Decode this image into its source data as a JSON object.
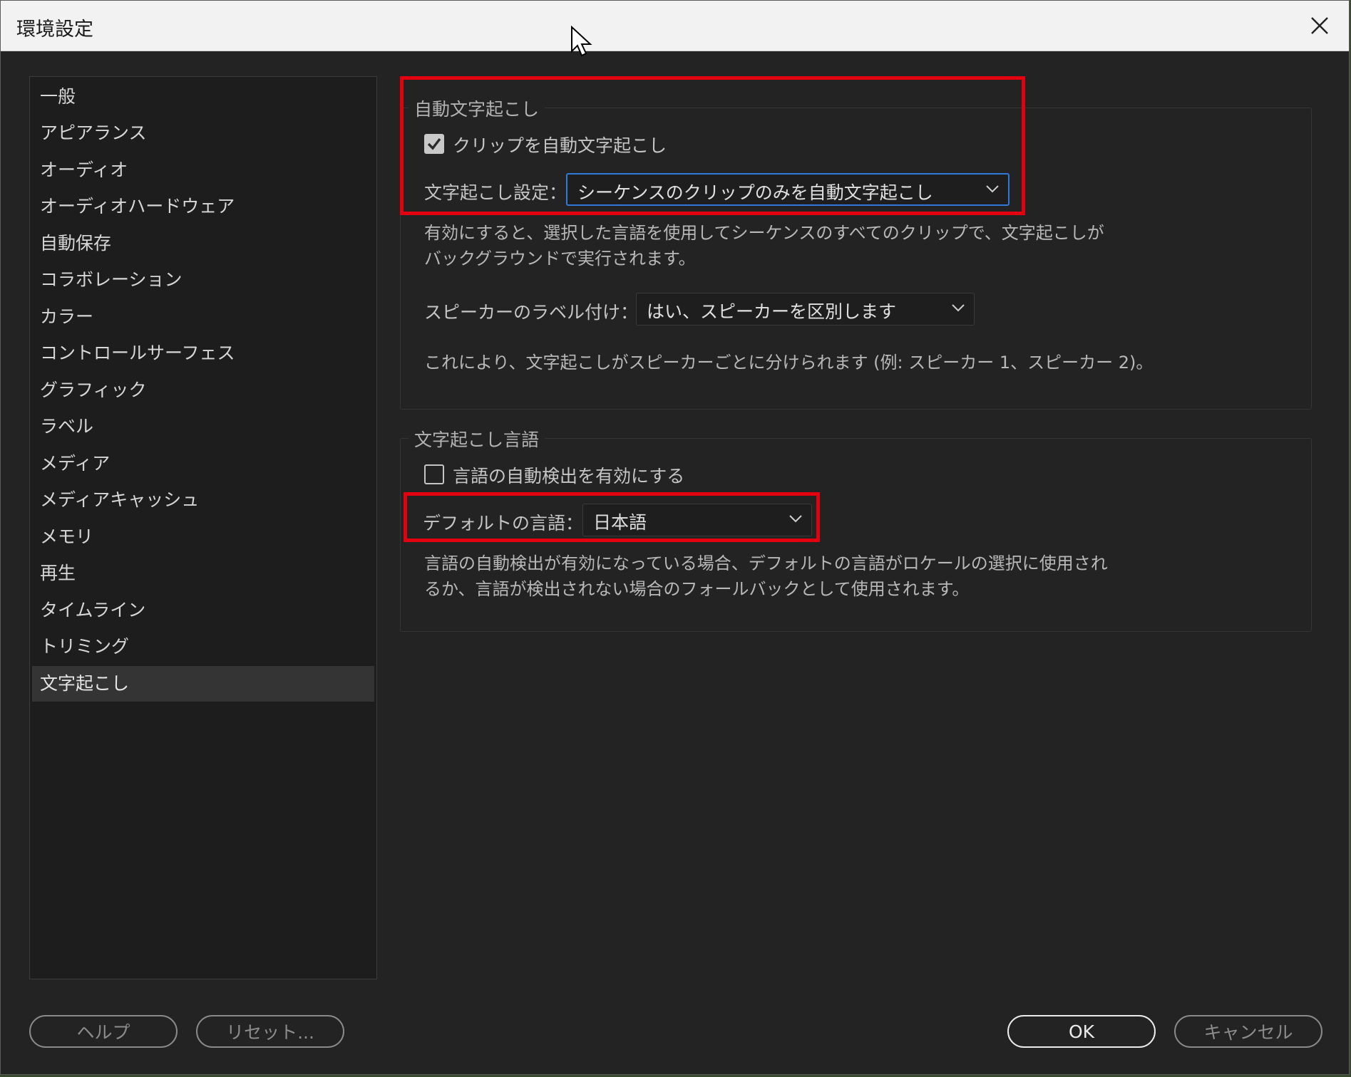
{
  "window": {
    "title": "環境設定"
  },
  "sidebar": {
    "items": [
      {
        "label": "一般"
      },
      {
        "label": "アピアランス"
      },
      {
        "label": "オーディオ"
      },
      {
        "label": "オーディオハードウェア"
      },
      {
        "label": "自動保存"
      },
      {
        "label": "コラボレーション"
      },
      {
        "label": "カラー"
      },
      {
        "label": "コントロールサーフェス"
      },
      {
        "label": "グラフィック"
      },
      {
        "label": "ラベル"
      },
      {
        "label": "メディア"
      },
      {
        "label": "メディアキャッシュ"
      },
      {
        "label": "メモリ"
      },
      {
        "label": "再生"
      },
      {
        "label": "タイムライン"
      },
      {
        "label": "トリミング"
      },
      {
        "label": "文字起こし"
      }
    ],
    "selected": "文字起こし"
  },
  "auto_transcribe": {
    "group_label": "自動文字起こし",
    "checkbox_label": "クリップを自動文字起こし",
    "checkbox_checked": true,
    "setting_label": "文字起こし設定：",
    "setting_value": "シーケンスのクリップのみを自動文字起こし",
    "help_text": "有効にすると、選択した言語を使用してシーケンスのすべてのクリップで、文字起こしが\nバックグラウンドで実行されます。",
    "speaker_label": "スピーカーのラベル付け：",
    "speaker_value": "はい、スピーカーを区別します",
    "speaker_help": "これにより、文字起こしがスピーカーごとに分けられます (例: スピーカー 1、スピーカー 2)。"
  },
  "language": {
    "group_label": "文字起こし言語",
    "checkbox_label": "言語の自動検出を有効にする",
    "checkbox_checked": false,
    "default_label": "デフォルトの言語：",
    "default_value": "日本語",
    "help_text": "言語の自動検出が有効になっている場合、デフォルトの言語がロケールの選択に使用され\nるか、言語が検出されない場合のフォールバックとして使用されます。"
  },
  "buttons": {
    "help": "ヘルプ",
    "reset": "リセット...",
    "ok": "OK",
    "cancel": "キャンセル"
  },
  "colors": {
    "highlight": "#e3000f",
    "focus": "#2f7ad8",
    "background": "#232323"
  }
}
